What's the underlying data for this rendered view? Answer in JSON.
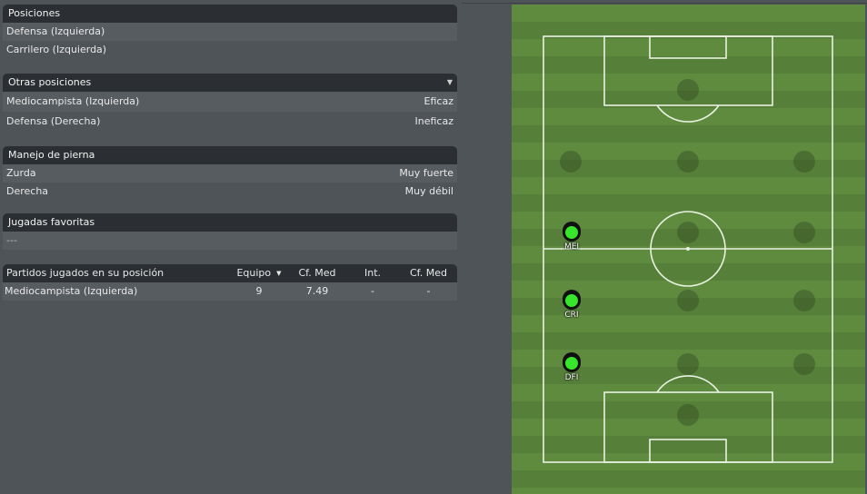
{
  "posiciones": {
    "title": "Posiciones",
    "items": [
      "Defensa (Izquierda)",
      "Carrilero (Izquierda)"
    ]
  },
  "otras_posiciones": {
    "title": "Otras posiciones",
    "items": [
      {
        "label": "Mediocampista (Izquierda)",
        "value": "Eficaz"
      },
      {
        "label": "Defensa (Derecha)",
        "value": "Ineficaz"
      }
    ]
  },
  "manejo_pierna": {
    "title": "Manejo de pierna",
    "items": [
      {
        "label": "Zurda",
        "value": "Muy fuerte"
      },
      {
        "label": "Derecha",
        "value": "Muy débil"
      }
    ]
  },
  "jugadas_favoritas": {
    "title": "Jugadas favoritas",
    "value": "---"
  },
  "partidos": {
    "headers": [
      "Partidos jugados en su posición",
      "Equipo",
      "Cf. Med",
      "Int.",
      "Cf. Med"
    ],
    "rows": [
      [
        "Mediocampista (Izquierda)",
        "9",
        "7.49",
        "-",
        "-"
      ]
    ]
  },
  "pitch": {
    "players": [
      {
        "label": "MEI"
      },
      {
        "label": "CRI"
      },
      {
        "label": "DFI"
      }
    ]
  }
}
